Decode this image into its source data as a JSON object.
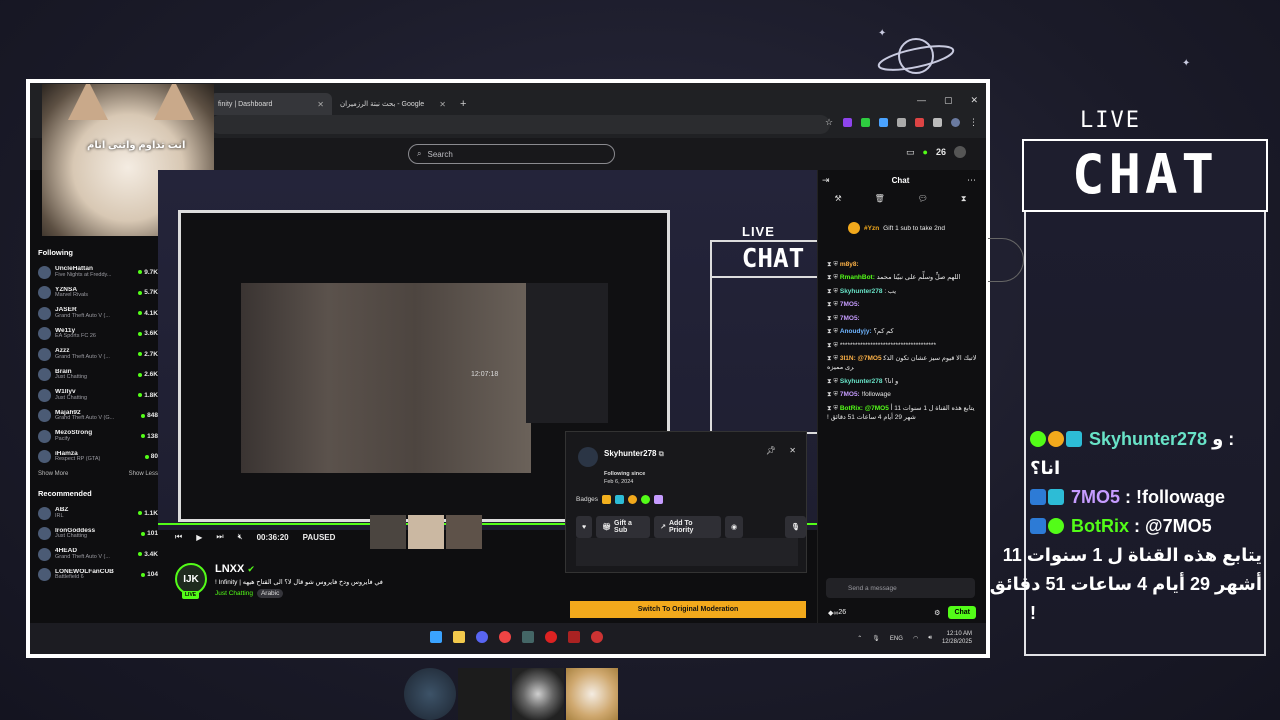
{
  "browser": {
    "tabs": [
      {
        "label": "finity | Dashboard"
      },
      {
        "label": "Google - بحث نبتة الرزميران"
      }
    ],
    "new_tab": "+"
  },
  "kick": {
    "search_placeholder": "Search",
    "header_count": "26",
    "following_heading": "Following",
    "following": [
      {
        "name": "UncleHattan",
        "cat": "Five Nights at Freddy...",
        "count": "9.7K"
      },
      {
        "name": "YZNSA",
        "cat": "Marvel Rivals",
        "count": "5.7K"
      },
      {
        "name": "JASER",
        "cat": "Grand Theft Auto V (...",
        "count": "4.1K"
      },
      {
        "name": "We11y",
        "cat": "EA Sports FC 26",
        "count": "3.6K"
      },
      {
        "name": "Azzz",
        "cat": "Grand Theft Auto V (...",
        "count": "2.7K"
      },
      {
        "name": "Brain",
        "cat": "Just Chatting",
        "count": "2.6K"
      },
      {
        "name": "W1llyv",
        "cat": "Just Chatting",
        "count": "1.8K"
      },
      {
        "name": "Majah92",
        "cat": "Grand Theft Auto V (G...",
        "count": "848"
      },
      {
        "name": "MezoStrong",
        "cat": "Pacify",
        "count": "138"
      },
      {
        "name": "iHamza",
        "cat": "Respect RP (GTA)",
        "count": "80"
      }
    ],
    "show_more": "Show More",
    "show_less": "Show Less",
    "recommended_heading": "Recommended",
    "recommended": [
      {
        "name": "ABZ",
        "cat": "IRL",
        "count": "1.1K"
      },
      {
        "name": "IronGoddess",
        "cat": "Just Chatting",
        "count": "101"
      },
      {
        "name": "4HEAD",
        "cat": "Grand Theft Auto V (...",
        "count": "3.4K"
      },
      {
        "name": "LONEWOLFanCUB",
        "cat": "Battlefield 6",
        "count": "104"
      }
    ],
    "cat_caption": "انت تداوم واتنی انام",
    "player": {
      "time": "00:36:20",
      "state": "PAUSED",
      "inner_clock": "12:07:18"
    },
    "channel": {
      "name": "LNXX",
      "avatar_text": "IJK",
      "live": "LIVE",
      "title": "في فايروس ودخ فايروس شو قال لا؟ الى القتاح هيهه | Infinity !",
      "category": "Just Chatting",
      "language": "Arabic"
    },
    "usercard": {
      "name": "Skyhunter278",
      "following_since_label": "Following since",
      "following_since": "Feb 6, 2024",
      "badges_label": "Badges",
      "gift_sub": "Gift a Sub",
      "add_priority": "Add To Priority"
    },
    "switch_moderation": "Switch To Original Moderation",
    "chat": {
      "header": "Chat",
      "pinned_user": "#Yzn",
      "pinned_text": "Gift 1 sub to take 2nd",
      "messages": [
        {
          "user": "m8y8:",
          "text": "",
          "color": "o"
        },
        {
          "user": "RmanhBot:",
          "text": "اللهم صلِّ وسلِّم على نبيّنا محمد",
          "color": "g"
        },
        {
          "user": "Skyhunter278",
          "text": "يب :",
          "color": "t"
        },
        {
          "user": "7MO5:",
          "text": "",
          "color": "p"
        },
        {
          "user": "7MO5:",
          "text": "",
          "color": "p"
        },
        {
          "user": "Anoudyjy:",
          "text": "كم كم؟",
          "color": "b"
        },
        {
          "user": "",
          "text": "**************************************",
          "color": "b"
        },
        {
          "user": "3I1N: @7MO5",
          "text": "لاتبك الا قيوم سيز عشان تكون الذكرى مميزه",
          "color": "o"
        },
        {
          "user": "Skyhunter278",
          "text": "و انا؟",
          "color": "t"
        },
        {
          "user": "7MO5:",
          "text": "!followage",
          "color": "p"
        },
        {
          "user": "BotRix: @7MO5",
          "text": "يتابع هذه القناة ل 1 سنوات 11 أشهر 29 أيام 4 ساعات 51 دقائق !",
          "color": "g"
        }
      ],
      "input_placeholder": "Send a message",
      "viewers": "26",
      "chat_button": "Chat"
    },
    "taskbar": {
      "lang": "ENG",
      "time": "12:10 AM",
      "date": "12/28/2025"
    },
    "mini_live": "LIVE",
    "mini_chat": "CHAT"
  },
  "overlay": {
    "live": "LIVE",
    "chat": "CHAT",
    "lines": [
      {
        "user": "Skyhunter278",
        "prefix": "و : ",
        "suffix": ""
      },
      {
        "text": "انا؟"
      },
      {
        "user": "7MO5",
        "text": " : !followage"
      },
      {
        "user": "BotRix",
        "text": " : @7MO5"
      },
      {
        "text": "يتابع هذه القناة ل 1 سنوات 11"
      },
      {
        "text": "أشهر 29 أيام 4 ساعات 51 دقائق"
      },
      {
        "text": "!"
      }
    ]
  }
}
